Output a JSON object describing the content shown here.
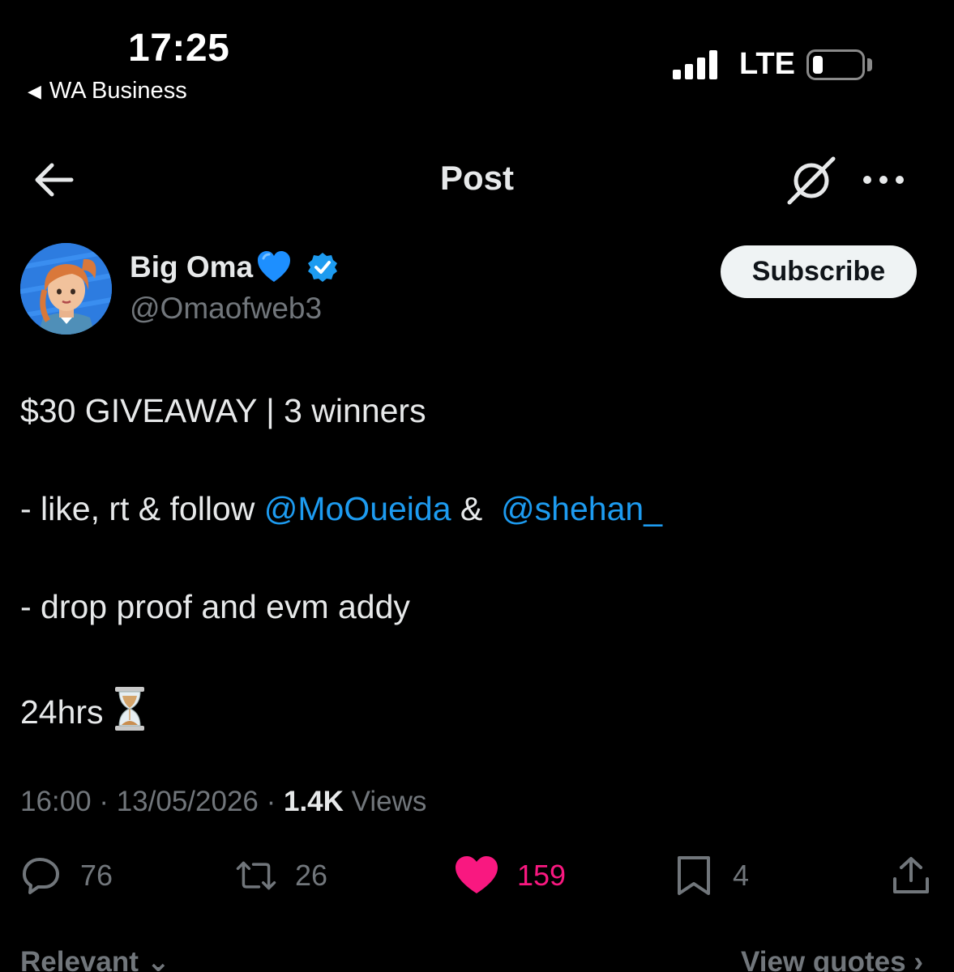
{
  "status_bar": {
    "time": "17:25",
    "back_app": "WA Business",
    "network": "LTE",
    "battery_level": 0.15
  },
  "header": {
    "title": "Post",
    "icons": [
      "back-arrow-icon",
      "grok-icon",
      "more-icon"
    ]
  },
  "author": {
    "name": "Big Oma",
    "handle": "@Omaofweb3",
    "verified": true,
    "subscribe_label": "Subscribe"
  },
  "tweet": {
    "line1": "$30 GIVEAWAY | 3 winners",
    "line2_prefix": "- like, rt & follow ",
    "mention1": "@MoOueida",
    "line2_mid": " &  ",
    "mention2": "@shehan_",
    "line3": "- drop proof and evm addy",
    "line4": "24hrs"
  },
  "meta": {
    "time": "16:00",
    "date": "13/05/2026",
    "views_count": "1.4K",
    "views_label": "Views"
  },
  "actions": {
    "replies": "76",
    "reposts": "26",
    "likes": "159",
    "bookmarks": "4"
  },
  "footer": {
    "sort_label": "Relevant",
    "quotes_label": "View quotes"
  },
  "colors": {
    "background": "#000000",
    "link": "#1d9bf0",
    "like": "#f91880",
    "muted": "#71767b",
    "verified": "#1d9bf0"
  }
}
